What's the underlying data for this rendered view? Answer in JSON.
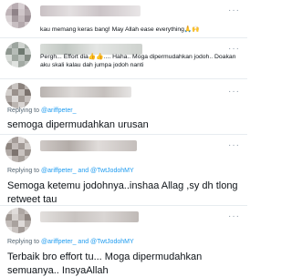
{
  "tweets": [
    {
      "text": "kau memang keras bang! May Allah ease everything🙏🙌"
    },
    {
      "text": "Pergh... Effort dia👍👍.... Haha.. Moga dipermudahkan jodoh.. Doakan aku skali kalau dah jumpa jodoh nanti"
    },
    {
      "reply_prefix": "Replying to",
      "handles": "@ariffpeter_",
      "text": "semoga dipermudahkan urusan"
    },
    {
      "reply_prefix": "Replying to",
      "handles": "@ariffpeter_ and @TwtJodohMY",
      "text": "Semoga ketemu jodohnya..inshaa Allag ,sy dh tlong retweet tau"
    },
    {
      "reply_prefix": "Replying to",
      "handles": "@ariffpeter_ and @TwtJodohMY",
      "text": "Terbaik bro effort tu... Moga dipermudahkan semuanya.. InsyaAllah"
    }
  ],
  "colors": {
    "link": "#1d9bf0",
    "muted": "#536471",
    "separator": "#e7ecf0"
  },
  "icons": {
    "more": "more-dots-icon"
  }
}
